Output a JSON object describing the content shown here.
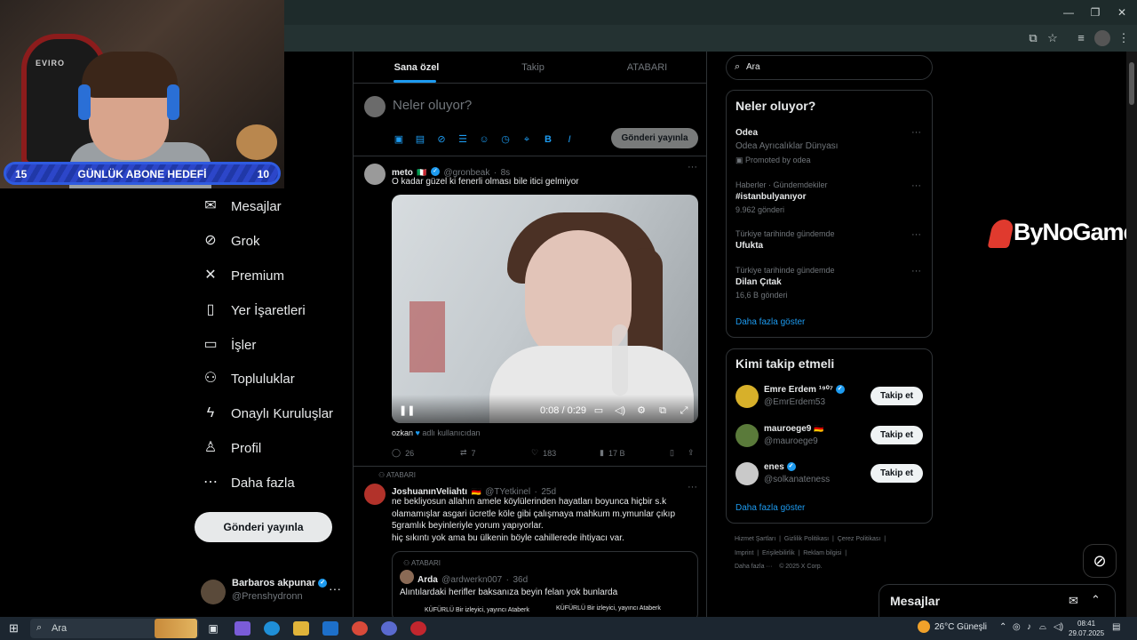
{
  "overlay": {
    "goal_left": "15",
    "goal_label": "GÜNLÜK ABONE HEDEFİ",
    "goal_right": "10",
    "chair_text": "EVIRO",
    "sponsor": "ByNoGame"
  },
  "nav": {
    "items": [
      {
        "label": "Mesajlar",
        "icon": "mail-icon"
      },
      {
        "label": "Grok",
        "icon": "grok-icon"
      },
      {
        "label": "Premium",
        "icon": "x-logo-icon"
      },
      {
        "label": "Yer İşaretleri",
        "icon": "bookmark-icon"
      },
      {
        "label": "İşler",
        "icon": "briefcase-icon"
      },
      {
        "label": "Topluluklar",
        "icon": "communities-icon"
      },
      {
        "label": "Onaylı Kuruluşlar",
        "icon": "lightning-icon"
      },
      {
        "label": "Profil",
        "icon": "person-icon"
      },
      {
        "label": "Daha fazla",
        "icon": "more-circle-icon"
      }
    ],
    "post_button": "Gönderi yayınla",
    "account": {
      "name": "Barbaros akpunar",
      "handle": "@Prenshydronn"
    }
  },
  "feed": {
    "tabs": [
      "Sana özel",
      "Takip",
      "ATABARI"
    ],
    "composer_placeholder": "Neler oluyor?",
    "composer_post": "Gönderi yayınla",
    "tweet1": {
      "name": "meto",
      "handle": "@gronbeak",
      "time": "8s",
      "text": "O kadar güzel ki fenerli olması bile itici gelmiyor",
      "video_time": "0:08 / 0:29",
      "credit_name": "ozkan",
      "credit_text": "adlı kullanıcıdan",
      "replies": "26",
      "reposts": "7",
      "likes": "183",
      "views": "17 B"
    },
    "tweet2": {
      "context": "ATABARI",
      "name": "JoshuanınVeliahtı",
      "handle": "@TYetkinel",
      "time": "25d",
      "line1": "ne bekliyosun allahın amele köylülerinden hayatları boyunca hiçbir s.k",
      "line2": "olamamışlar asgari ücretle köle gibi çalışmaya mahkum m.ymunlar çıkıp",
      "line3": "5gramlık beyinleriyle yorum yapıyorlar.",
      "line4": "hiç sıkıntı yok ama bu ülkenin böyle cahillerede ihtiyacı var.",
      "quote": {
        "context": "ATABARI",
        "name": "Arda",
        "handle": "@ardwerkn007",
        "time": "36d",
        "text": "Alıntılardaki herifler baksanıza beyin felan yok bunlarda",
        "img_left": "KÜFÜRLÜ Bir izleyici, yayıncı Ataberk",
        "img_right": "KÜFÜRLÜ Bir izleyici, yayıncı Ataberk"
      }
    }
  },
  "sidebar": {
    "search_placeholder": "Ara",
    "trends_title": "Neler oluyor?",
    "trends": [
      {
        "name": "Odea",
        "sub": "Odea Ayrıcalıklar Dünyası",
        "meta": "Promoted by odea"
      },
      {
        "context": "Haberler · Gündemdekiler",
        "name": "#istanbulyanıyor",
        "meta": "9.962 gönderi"
      },
      {
        "context": "Türkiye tarihinde gündemde",
        "name": "Ufukta"
      },
      {
        "context": "Türkiye tarihinde gündemde",
        "name": "Dilan Çıtak",
        "meta": "16,6 B gönderi"
      }
    ],
    "show_more": "Daha fazla göster",
    "who_title": "Kimi takip etmeli",
    "who": [
      {
        "name": "Emre Erdem ¹⁹⁰⁷",
        "handle": "@EmrErdem53"
      },
      {
        "name": "mauroege9",
        "handle": "@mauroege9"
      },
      {
        "name": "enes",
        "handle": "@solkanateness"
      }
    ],
    "follow_label": "Takip et",
    "footer": [
      "Hizmet Şartları",
      "Gizlilik Politikası",
      "Çerez Politikası",
      "Imprint",
      "Erişilebilirlik",
      "Reklam bilgisi",
      "Daha fazla ···",
      "© 2025 X Corp."
    ]
  },
  "dock": {
    "messages_title": "Mesajlar"
  },
  "taskbar": {
    "search": "Ara",
    "weather": "26°C  Güneşli",
    "time": "08:41",
    "date": "29.07.2025"
  },
  "colors": {
    "accent": "#1d9bf0",
    "border": "#2f3336",
    "muted": "#71767b"
  }
}
